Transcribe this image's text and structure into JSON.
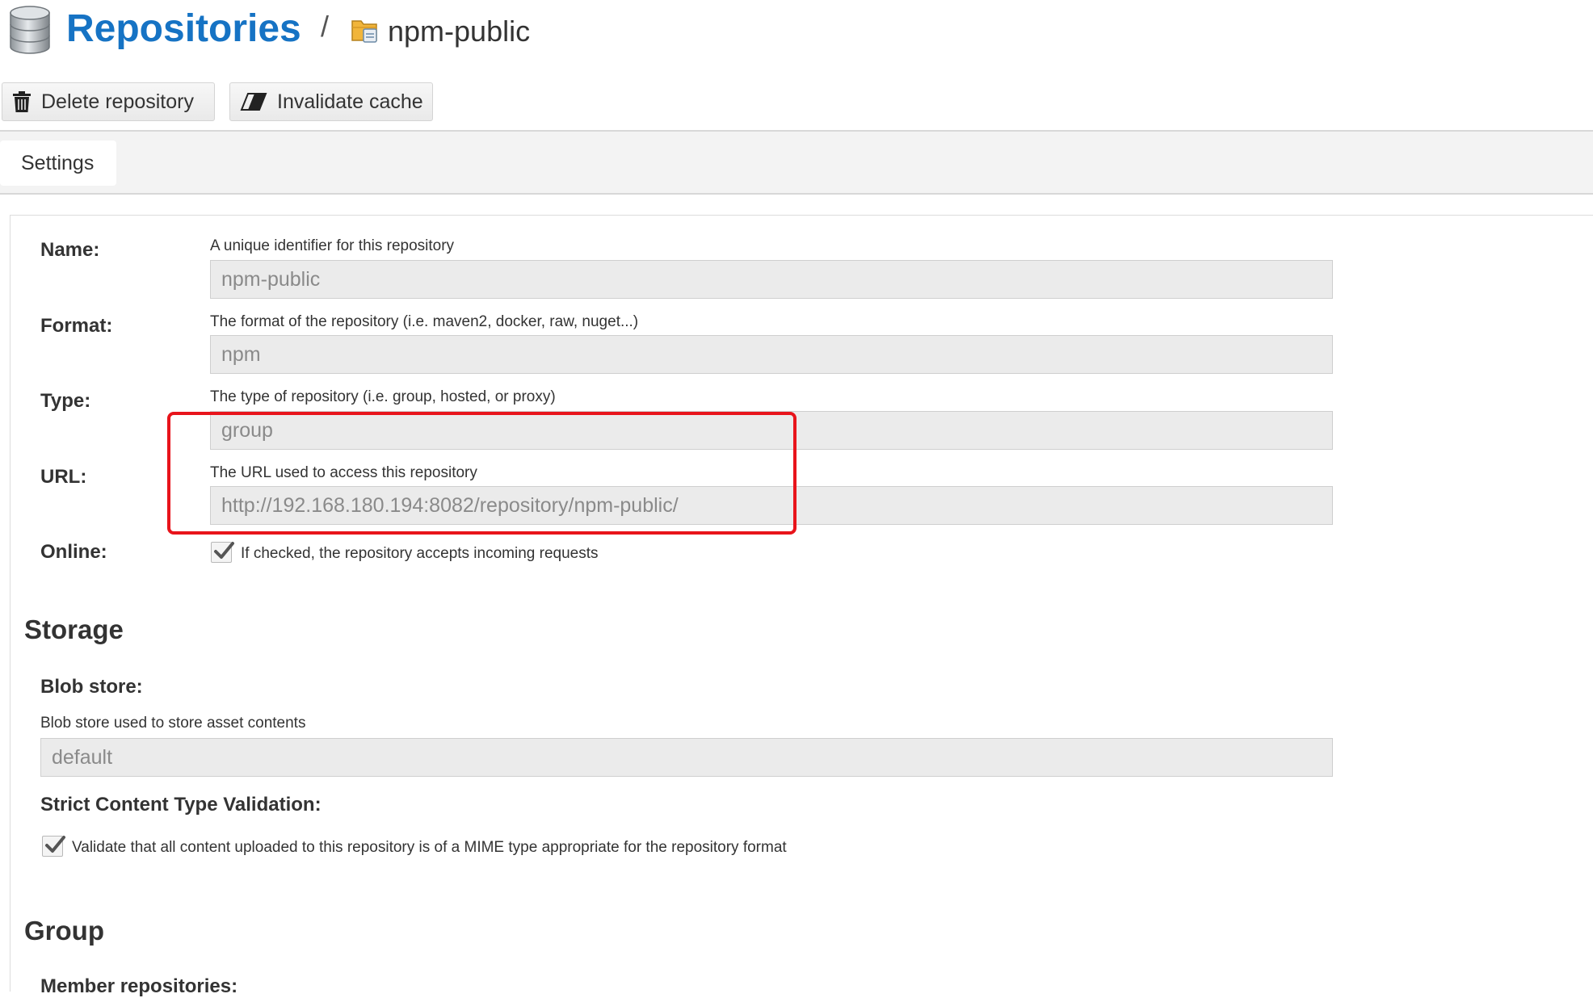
{
  "header": {
    "icon": "database-icon",
    "title": "Repositories",
    "separator": "/",
    "repo_icon": "folder-icon",
    "repo_name": "npm-public",
    "title_color": "#1673c4"
  },
  "toolbar": {
    "delete_label": "Delete repository",
    "delete_icon": "trash-icon",
    "invalidate_label": "Invalidate cache",
    "invalidate_icon": "eraser-icon"
  },
  "tabs": [
    {
      "label": "Settings",
      "active": true
    }
  ],
  "form": {
    "name": {
      "label": "Name:",
      "help": "A unique identifier for this repository",
      "value": "npm-public"
    },
    "format": {
      "label": "Format:",
      "help": "The format of the repository (i.e. maven2, docker, raw, nuget...)",
      "value": "npm"
    },
    "type": {
      "label": "Type:",
      "help": "The type of repository (i.e. group, hosted, or proxy)",
      "value": "group"
    },
    "url": {
      "label": "URL:",
      "help": "The URL used to access this repository",
      "value": "http://192.168.180.194:8082/repository/npm-public/"
    },
    "online": {
      "label": "Online:",
      "checked": true,
      "help": "If checked, the repository accepts incoming requests"
    }
  },
  "storage": {
    "title": "Storage",
    "blob_store": {
      "label": "Blob store:",
      "help": "Blob store used to store asset contents",
      "value": "default"
    },
    "strict": {
      "label": "Strict Content Type Validation:",
      "checked": true,
      "help": "Validate that all content uploaded to this repository is of a MIME type appropriate for the repository format"
    }
  },
  "group": {
    "title": "Group",
    "members_label": "Member repositories:"
  },
  "annotation": {
    "color": "#e8141b"
  }
}
